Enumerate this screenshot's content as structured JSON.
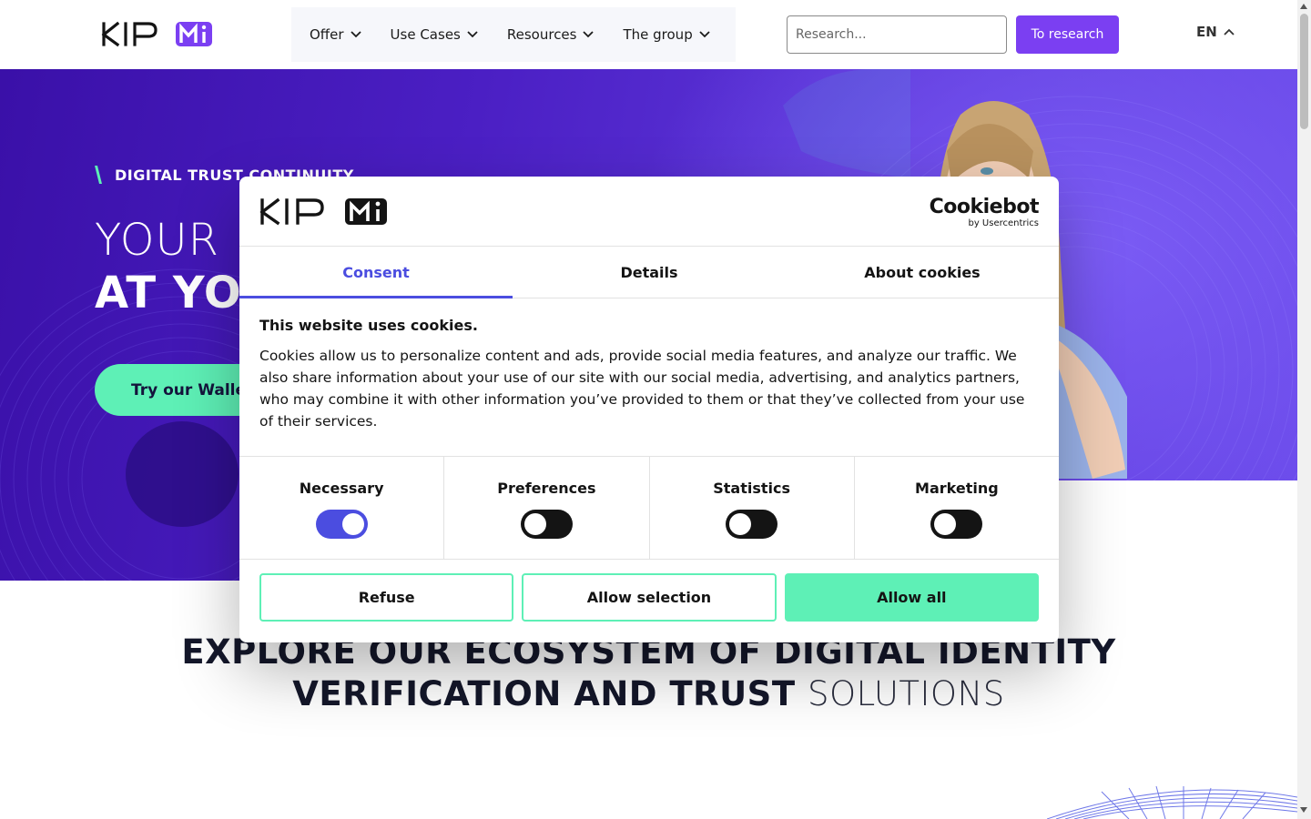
{
  "header": {
    "logo_alt": "KIP Mi",
    "nav": [
      {
        "label": "Offer"
      },
      {
        "label": "Use Cases"
      },
      {
        "label": "Resources"
      },
      {
        "label": "The group"
      }
    ],
    "search": {
      "placeholder": "Research...",
      "button_label": "To research"
    },
    "language": "EN"
  },
  "hero": {
    "eyebrow": "DIGITAL TRUST CONTINUITY",
    "line1": "YOUR D",
    "line2": "AT YO",
    "cta_label": "Try our Walle"
  },
  "section": {
    "title_bold_1": "EXPLORE OUR ECOSYSTEM OF DIGITAL IDENTITY",
    "title_bold_2": "VERIFICATION AND TRUST",
    "title_thin": "SOLUTIONS"
  },
  "cookie_modal": {
    "brand": {
      "name": "Cookiebot",
      "by": "by Usercentrics"
    },
    "tabs": [
      {
        "label": "Consent",
        "active": true
      },
      {
        "label": "Details",
        "active": false
      },
      {
        "label": "About cookies",
        "active": false
      }
    ],
    "title": "This website uses cookies.",
    "text": "Cookies allow us to personalize content and ads, provide social media features, and analyze our traffic. We also share information about your use of our site with our social media, advertising, and analytics partners, who may combine it with other information you’ve provided to them or that they’ve collected from your use of their services.",
    "categories": [
      {
        "label": "Necessary",
        "enabled": true
      },
      {
        "label": "Preferences",
        "enabled": false
      },
      {
        "label": "Statistics",
        "enabled": false
      },
      {
        "label": "Marketing",
        "enabled": false
      }
    ],
    "buttons": {
      "refuse": "Refuse",
      "allow_selection": "Allow selection",
      "allow_all": "Allow all"
    }
  },
  "colors": {
    "accent_purple": "#7b3ff2",
    "consent_blue": "#4b4de0",
    "mint": "#5ef0b6",
    "hero_dark": "#3a10a8"
  }
}
